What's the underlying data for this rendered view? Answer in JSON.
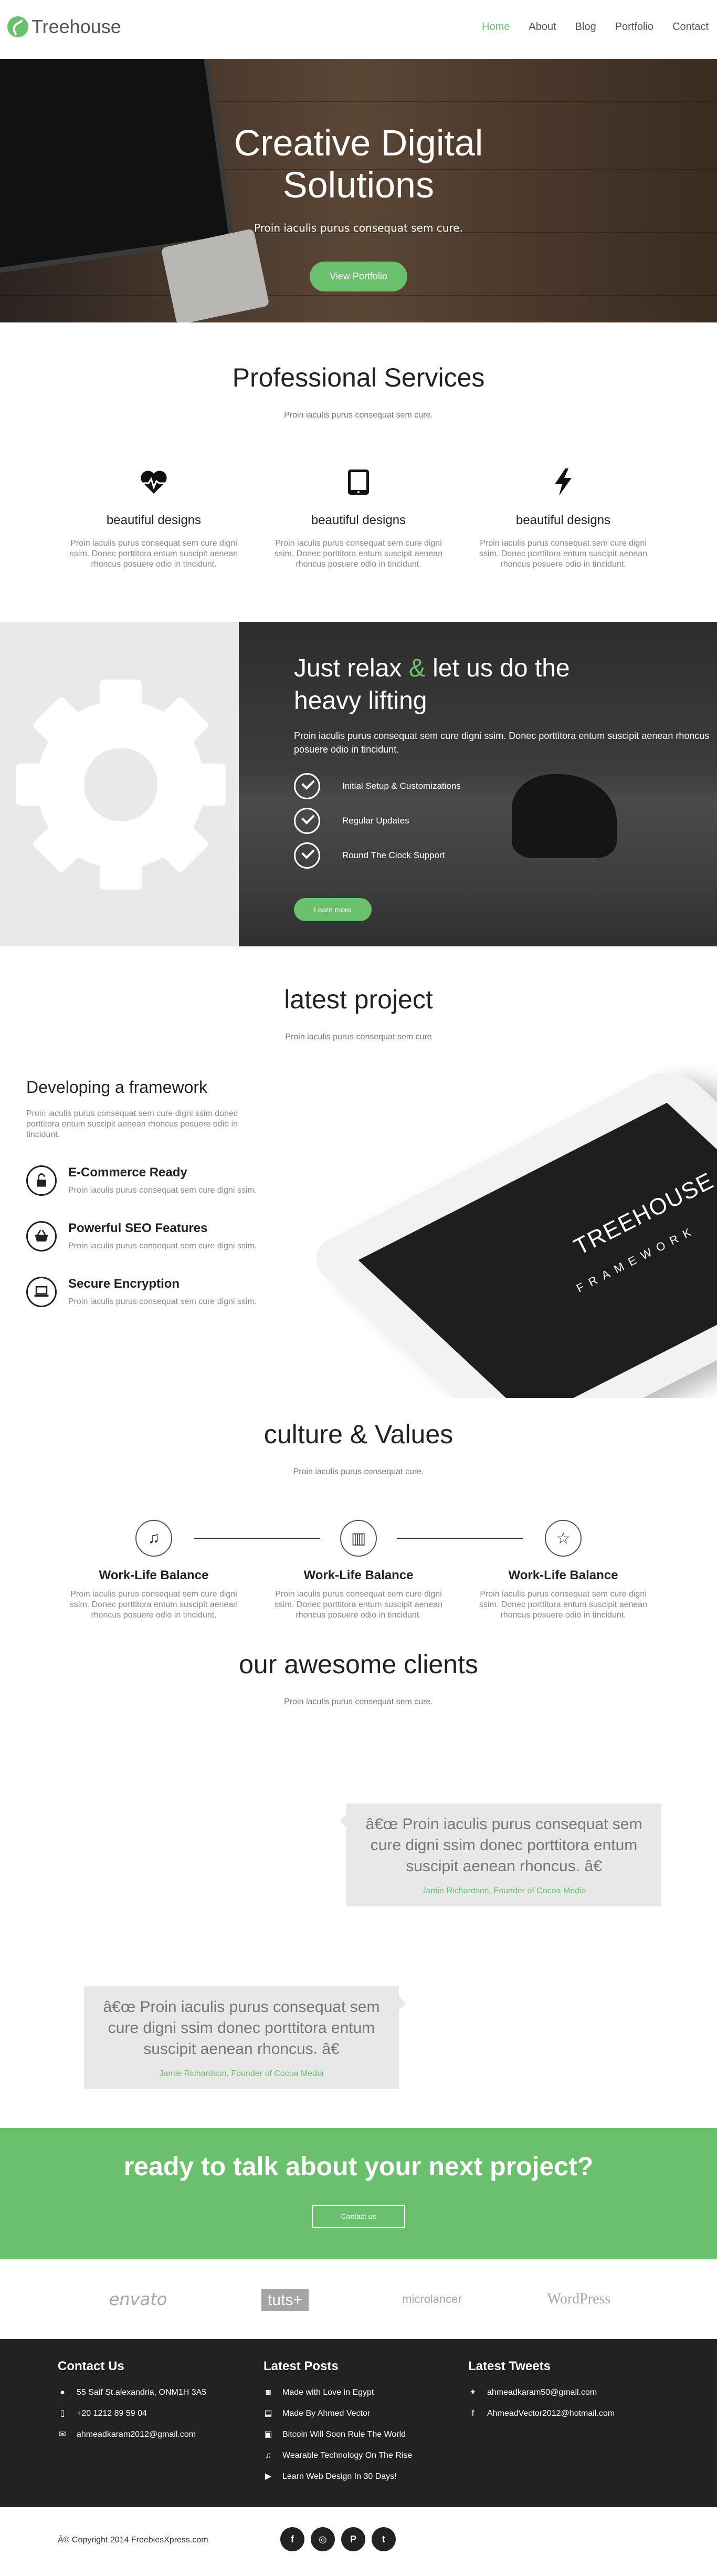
{
  "nav": {
    "logo_text": "Treehouse",
    "items": [
      {
        "label": "Home",
        "active": true
      },
      {
        "label": "About"
      },
      {
        "label": "Blog"
      },
      {
        "label": "Portfolio"
      },
      {
        "label": "Contact"
      }
    ]
  },
  "hero": {
    "title": "Creative Digital Solutions",
    "subtitle": "Proin iaculis purus consequat sem cure.",
    "button": "View Portfolio"
  },
  "services": {
    "title": "Professional Services",
    "subtitle": "Proin iaculis purus consequat sem cure.",
    "items": [
      {
        "icon": "heartbeat-icon",
        "title": "beautiful designs",
        "text": "Proin iaculis purus consequat sem cure digni ssim. Donec porttitora entum suscipit aenean rhoncus posuere odio in tincidunt."
      },
      {
        "icon": "tablet-icon",
        "title": "beautiful designs",
        "text": "Proin iaculis purus consequat sem cure digni ssim. Donec porttitora entum suscipit aenean rhoncus posuere odio in tincidunt."
      },
      {
        "icon": "lightning-icon",
        "title": "beautiful designs",
        "text": "Proin iaculis purus consequat sem cure digni ssim. Donec porttitora entum suscipit aenean rhoncus posuere odio in tincidunt."
      }
    ]
  },
  "relax": {
    "title_start": "Just relax ",
    "title_amp": "&",
    "title_end": " let us do the heavy lifting",
    "text": "Proin iaculis purus consequat sem cure digni ssim. Donec porttitora entum suscipit aenean rhoncus posuere odio in tincidunt.",
    "checks": [
      "Initial Setup & Customizations",
      "Regular Updates",
      "Round The Clock Support"
    ],
    "button": "Learn more",
    "accent": "#6ac06d"
  },
  "project": {
    "title": "latest project",
    "subtitle": "Proin iaculis purus consequat sem cure",
    "heading": "Developing a framework",
    "text": "Proin iaculis purus consequat sem cure digni ssim donec porttitora entum suscipit aenean rhoncus posuere odio in tincidunt.",
    "features": [
      {
        "icon": "unlock-icon",
        "title": "E-Commerce Ready",
        "text": "Proin iaculis purus consequat sem cure digni ssim."
      },
      {
        "icon": "basket-icon",
        "title": "Powerful SEO Features",
        "text": "Proin iaculis purus consequat sem cure digni ssim."
      },
      {
        "icon": "laptop-icon",
        "title": "Secure Encryption",
        "text": "Proin iaculis purus consequat sem cure digni ssim."
      }
    ],
    "tablet_title": "TREEHOUSE",
    "tablet_sub": "FRAMEWORK"
  },
  "culture": {
    "title": "culture & Values",
    "subtitle": "Proin iaculis purus consequat cure.",
    "items": [
      {
        "icon": "music-icon",
        "glyph": "♫",
        "title": "Work-Life Balance",
        "text": "Proin iaculis purus consequat sem cure digni ssim. Donec porttitora entum suscipit aenean rhoncus posuere odio in tincidunt."
      },
      {
        "icon": "chart-icon",
        "glyph": "▥",
        "title": "Work-Life Balance",
        "text": "Proin iaculis purus consequat sem cure digni ssim. Donec porttitora entum suscipit aenean rhoncus posuere odio in tincidunt."
      },
      {
        "icon": "star-icon",
        "glyph": "☆",
        "title": "Work-Life Balance",
        "text": "Proin iaculis purus consequat sem cure digni ssim. Donec porttitora entum suscipit aenean rhoncus posuere odio in tincidunt."
      }
    ]
  },
  "clients": {
    "title": "our awesome clients",
    "subtitle": "Proin iaculis purus consequat sem cure.",
    "quotes": [
      {
        "text": "â€œ Proin iaculis purus consequat sem cure digni ssim donec porttitora entum suscipit aenean rhoncus. â€",
        "by": "Jamie Richardson, Founder of Cocoa Media"
      },
      {
        "text": "â€œ Proin iaculis purus consequat sem cure digni ssim donec porttitora entum suscipit aenean rhoncus. â€",
        "by": "Jamie Richardson, Founder of Cocoa Media"
      }
    ]
  },
  "cta": {
    "title": "ready to talk about your next project?",
    "button": "Contact us"
  },
  "partners": [
    "envato",
    "tuts+",
    "microlancer",
    "WordPress"
  ],
  "footer": {
    "contact": {
      "title": "Contact Us",
      "items": [
        {
          "icon": "map-pin-icon",
          "text": "55 Saif St.alexandria, ONM1H 3A5"
        },
        {
          "icon": "mobile-icon",
          "text": "+20 1212 89 59 04"
        },
        {
          "icon": "envelope-icon",
          "text": "ahmeadkaram2012@gmail.com"
        }
      ]
    },
    "posts": {
      "title": "Latest Posts",
      "items": [
        {
          "icon": "camera-icon",
          "text": "Made with Love in Egypt"
        },
        {
          "icon": "book-icon",
          "text": "Made By Ahmed Vector"
        },
        {
          "icon": "photo-icon",
          "text": "Bitcoin Will Soon Rule The World"
        },
        {
          "icon": "music-icon",
          "text": "Wearable Technology On The Rise"
        },
        {
          "icon": "play-icon",
          "text": "Learn Web Design In 30 Days!"
        }
      ]
    },
    "tweets": {
      "title": "Latest Tweets",
      "items": [
        {
          "icon": "twitter-icon",
          "text": "ahmeadkaram50@gmail.com"
        },
        {
          "icon": "facebook-icon",
          "text": "AhmeadVector2012@hotmail.com"
        }
      ]
    }
  },
  "bottom": {
    "copyright": "Â© Copyright 2014 FreebiesXpress.com",
    "socials": [
      {
        "icon": "facebook-icon",
        "glyph": "f"
      },
      {
        "icon": "dribbble-icon",
        "glyph": "◎"
      },
      {
        "icon": "pinterest-icon",
        "glyph": "P"
      },
      {
        "icon": "twitter-icon",
        "glyph": "t"
      }
    ]
  }
}
